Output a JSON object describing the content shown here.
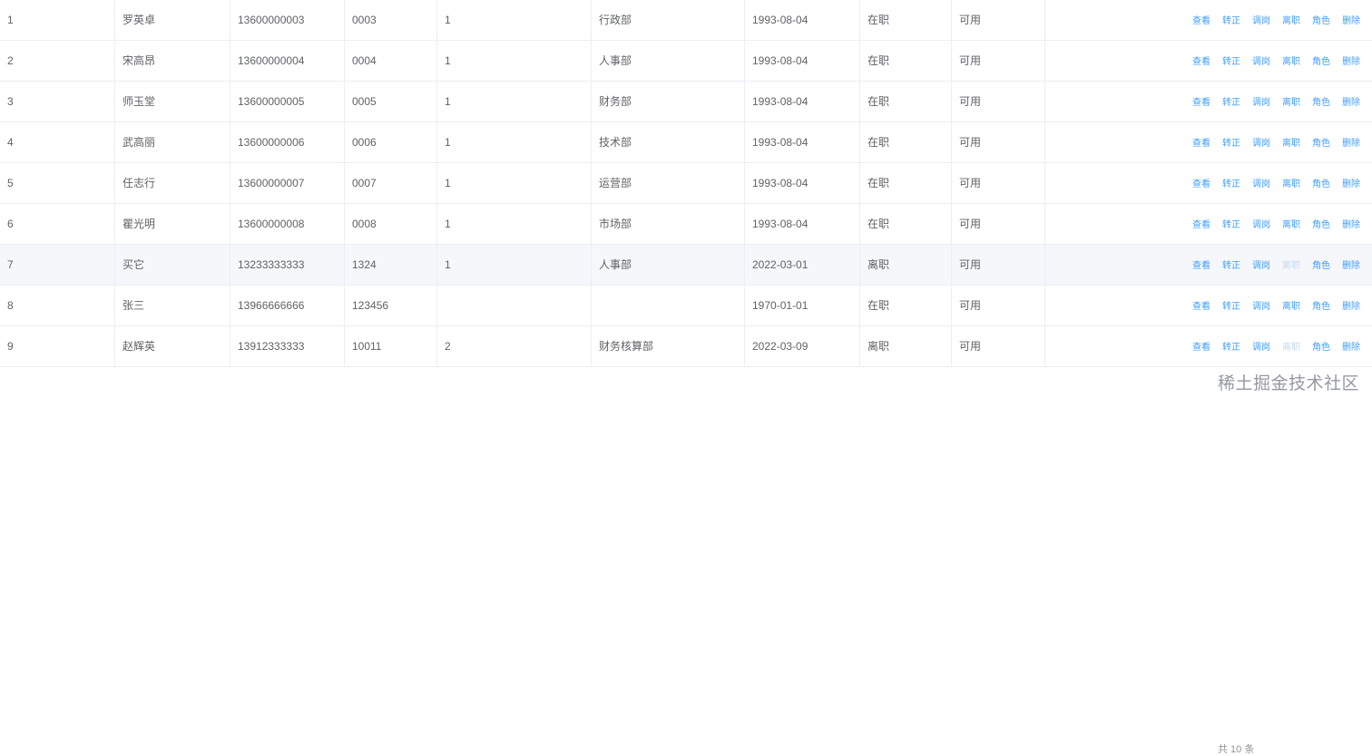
{
  "table": {
    "operations": [
      "查看",
      "转正",
      "调岗",
      "离职",
      "角色",
      "删除"
    ],
    "rows": [
      {
        "index": "1",
        "name": "罗英卓",
        "phone": "13600000003",
        "work_no": "0003",
        "form": "1",
        "dept": "行政部",
        "hire_date": "1993-08-04",
        "status": "在职",
        "enabled": "可用",
        "leave_disabled": false
      },
      {
        "index": "2",
        "name": "宋高昂",
        "phone": "13600000004",
        "work_no": "0004",
        "form": "1",
        "dept": "人事部",
        "hire_date": "1993-08-04",
        "status": "在职",
        "enabled": "可用",
        "leave_disabled": false
      },
      {
        "index": "3",
        "name": "师玉堂",
        "phone": "13600000005",
        "work_no": "0005",
        "form": "1",
        "dept": "财务部",
        "hire_date": "1993-08-04",
        "status": "在职",
        "enabled": "可用",
        "leave_disabled": false
      },
      {
        "index": "4",
        "name": "武高丽",
        "phone": "13600000006",
        "work_no": "0006",
        "form": "1",
        "dept": "技术部",
        "hire_date": "1993-08-04",
        "status": "在职",
        "enabled": "可用",
        "leave_disabled": false
      },
      {
        "index": "5",
        "name": "任志行",
        "phone": "13600000007",
        "work_no": "0007",
        "form": "1",
        "dept": "运营部",
        "hire_date": "1993-08-04",
        "status": "在职",
        "enabled": "可用",
        "leave_disabled": false
      },
      {
        "index": "6",
        "name": "瞿光明",
        "phone": "13600000008",
        "work_no": "0008",
        "form": "1",
        "dept": "市场部",
        "hire_date": "1993-08-04",
        "status": "在职",
        "enabled": "可用",
        "leave_disabled": false
      },
      {
        "index": "7",
        "name": "买它",
        "phone": "13233333333",
        "work_no": "1324",
        "form": "1",
        "dept": "人事部",
        "hire_date": "2022-03-01",
        "status": "离职",
        "enabled": "可用",
        "leave_disabled": true
      },
      {
        "index": "8",
        "name": "张三",
        "phone": "13966666666",
        "work_no": "123456",
        "form": "",
        "dept": "",
        "hire_date": "1970-01-01",
        "status": "在职",
        "enabled": "可用",
        "leave_disabled": false
      },
      {
        "index": "9",
        "name": "赵辉英",
        "phone": "13912333333",
        "work_no": "10011",
        "form": "2",
        "dept": "财务核算部",
        "hire_date": "2022-03-09",
        "status": "离职",
        "enabled": "可用",
        "leave_disabled": true
      }
    ],
    "hover_row": 6
  },
  "footer": {
    "pager_hint": "共 10 条",
    "watermark": "稀土掘金技术社区"
  }
}
